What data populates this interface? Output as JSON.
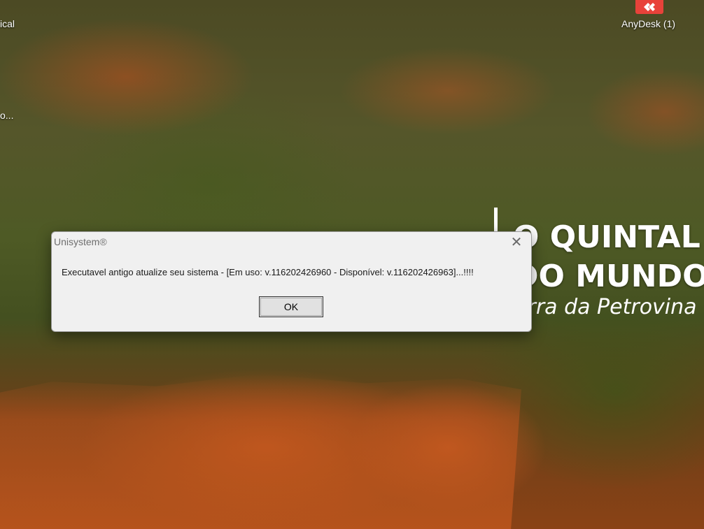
{
  "desktop": {
    "icons": [
      {
        "label": "ical"
      },
      {
        "label": "o..."
      },
      {
        "label": "AnyDesk (1)"
      }
    ],
    "wallpaper_text": {
      "line1": "O QUINTAL",
      "line2": "DO MUNDO",
      "line3": "Serra da Petrovina"
    }
  },
  "dialog": {
    "title": "Unisystem®",
    "close_symbol": "✕",
    "message": "Executavel antigo atualize seu sistema - [Em uso: v.116202426960 - Disponível: v.116202426963]...!!!!",
    "ok_label": "OK"
  },
  "colors": {
    "anydesk_red": "#e8423a",
    "dialog_bg": "#f0f0f0"
  }
}
